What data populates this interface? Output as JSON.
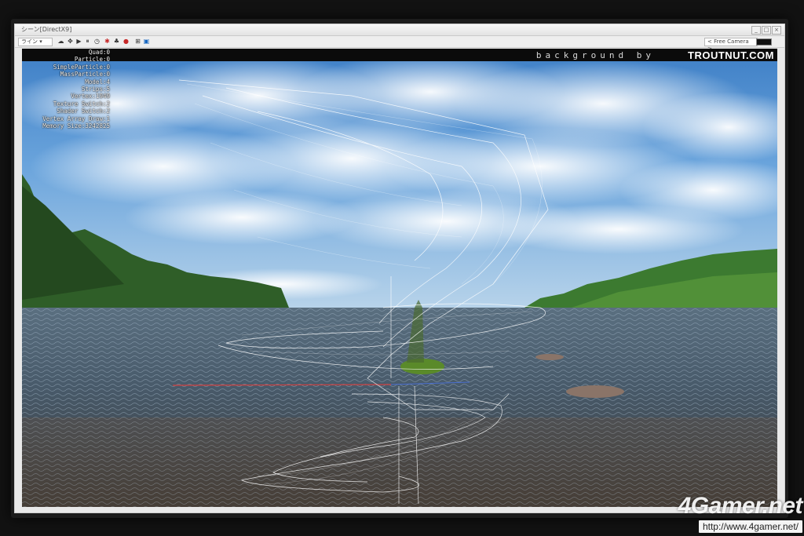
{
  "window": {
    "title": "シーン[DirectX9]",
    "controls": [
      "_",
      "□",
      "×"
    ]
  },
  "toolbar": {
    "mode_dropdown": "ライン",
    "camera_dropdown": "< Free Camera >"
  },
  "overlay": {
    "background_credit": "background by",
    "brand": "TROUTNUT.COM"
  },
  "stats": [
    "Quad:0",
    "Particle:0",
    "SimpleParticle:0",
    "MassParticle:0",
    "Model:4",
    "Strips:5",
    "Vertex:1949",
    "Texture Switch:2",
    "Shader Switch:2",
    "Vertex Array Draw:1",
    "Memory Size:3242825"
  ],
  "watermark": {
    "logo": "4Gamer.net",
    "url": "http://www.4gamer.net/"
  },
  "icons": [
    "camera-icon",
    "move-icon",
    "play-icon",
    "pause-icon",
    "clock-icon",
    "bug-icon",
    "tree-icon",
    "record-icon",
    "grid-icon",
    "display-icon"
  ],
  "colors": {
    "sky": "#5a97d4",
    "water": "#3c4a58",
    "foliage": "#2f6a2a",
    "wireframe": "#ffffff"
  }
}
